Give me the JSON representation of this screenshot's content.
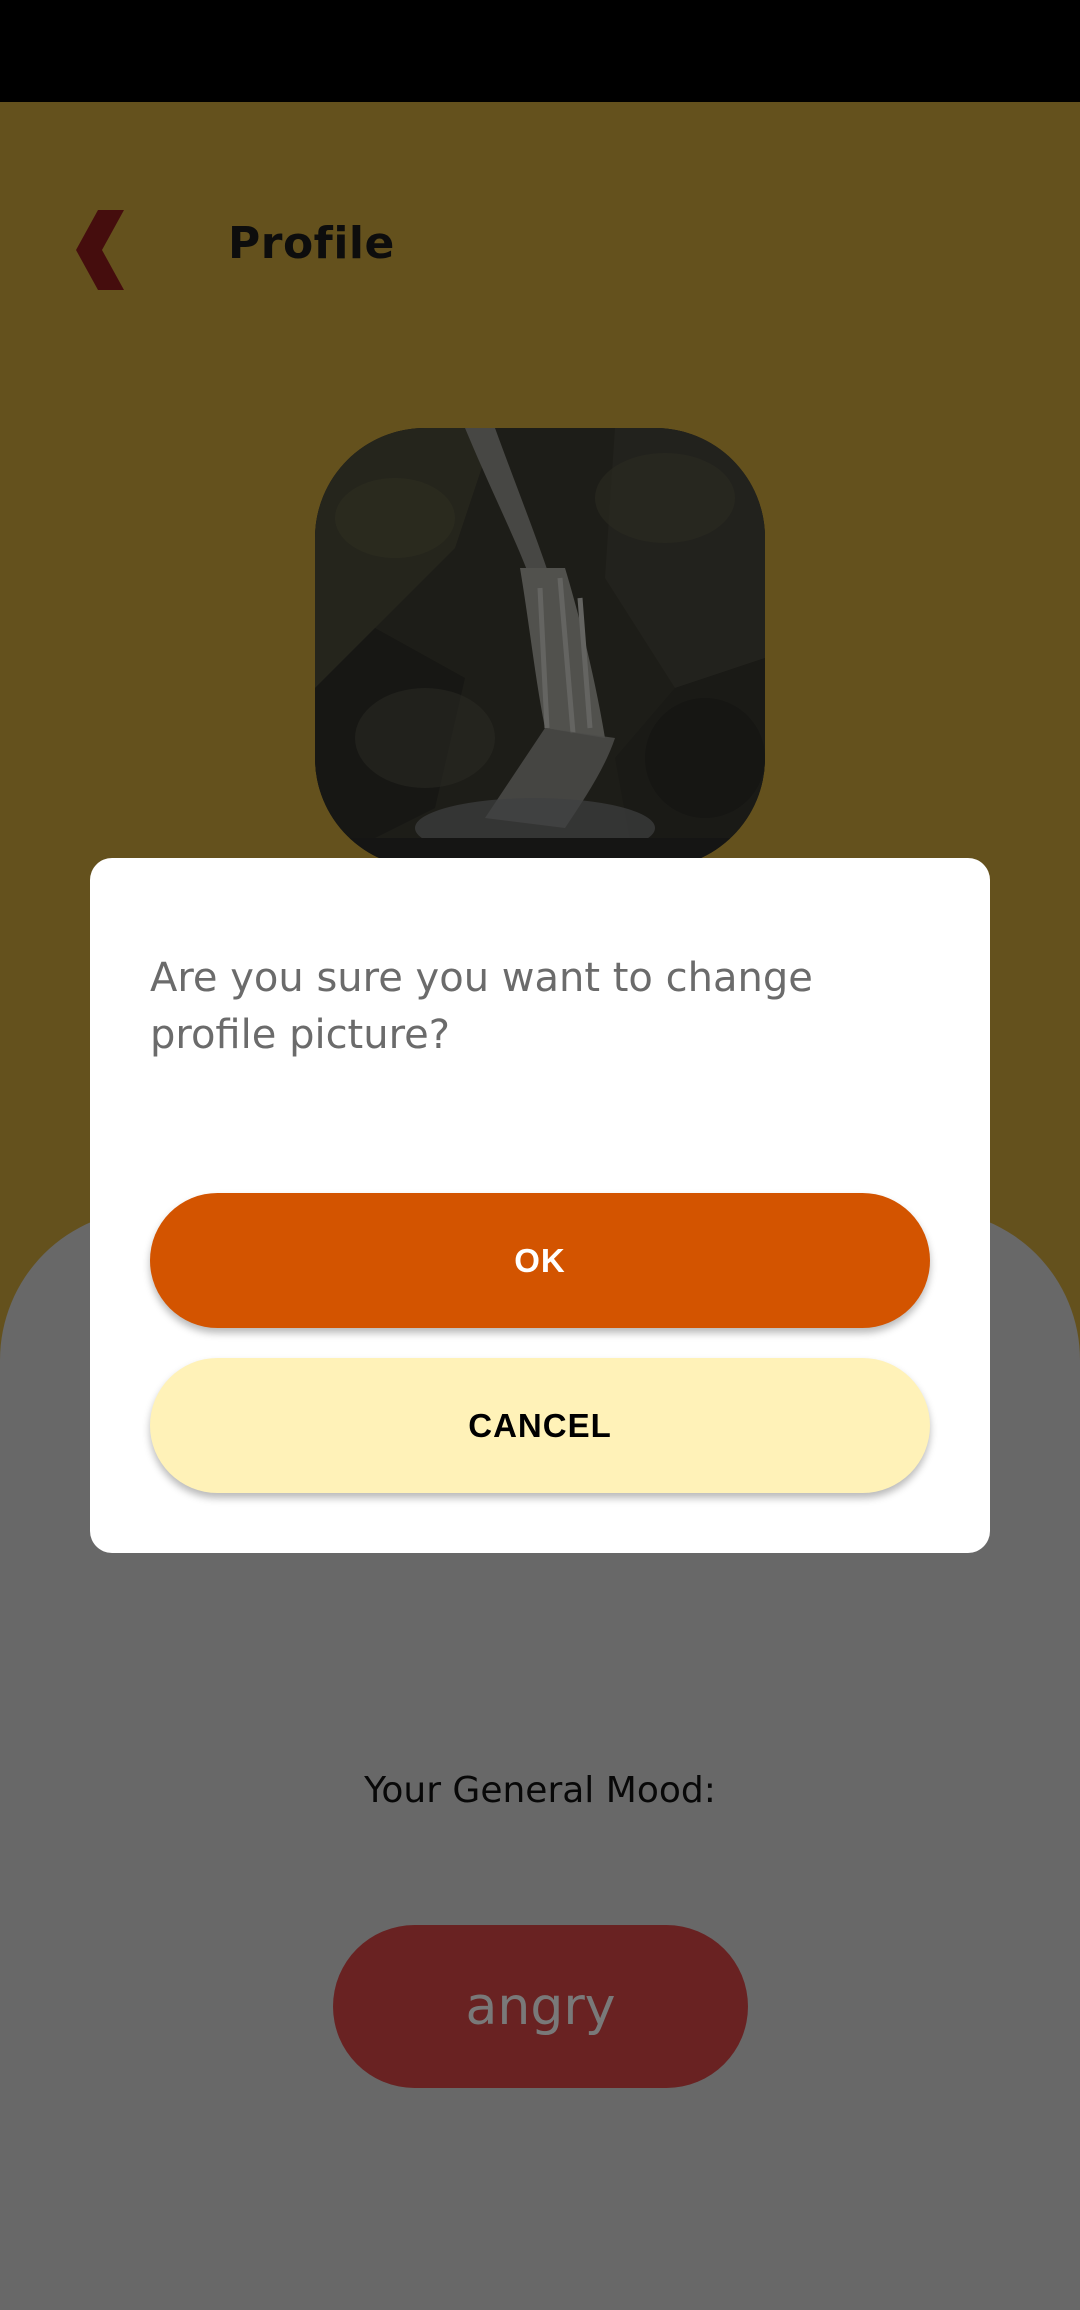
{
  "header": {
    "title": "Profile"
  },
  "mood": {
    "label": "Your General Mood:",
    "value": "angry"
  },
  "dialog": {
    "message": "Are you sure you want to change profile picture?",
    "ok_label": "OK",
    "cancel_label": "CANCEL"
  },
  "icons": {
    "back": "chevron-left-icon"
  },
  "colors": {
    "app_background": "#C9A33A",
    "back_icon": "#8B1A1A",
    "mood_pill": "#D24444",
    "ok_button": "#D35400",
    "cancel_button": "#FFF2B8",
    "dialog_background": "#FFFFFF"
  }
}
